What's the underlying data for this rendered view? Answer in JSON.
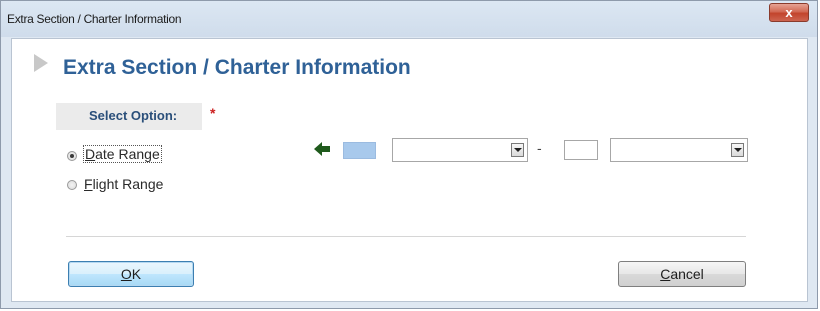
{
  "window": {
    "title": "Extra Section / Charter Information",
    "close_label": "x"
  },
  "header": {
    "title": "Extra Section / Charter Information"
  },
  "form": {
    "select_option_label": "Select Option:",
    "required_marker": "*",
    "options": [
      {
        "label": "Date Range",
        "selected": true
      },
      {
        "label": "Flight Range",
        "selected": false
      }
    ],
    "range_separator": "-",
    "color_indicator": "#a8c9ec"
  },
  "buttons": {
    "ok_label": "OK",
    "cancel_label": "Cancel"
  },
  "colors": {
    "accent_title": "#2f6197",
    "required": "#cc1f1f"
  }
}
